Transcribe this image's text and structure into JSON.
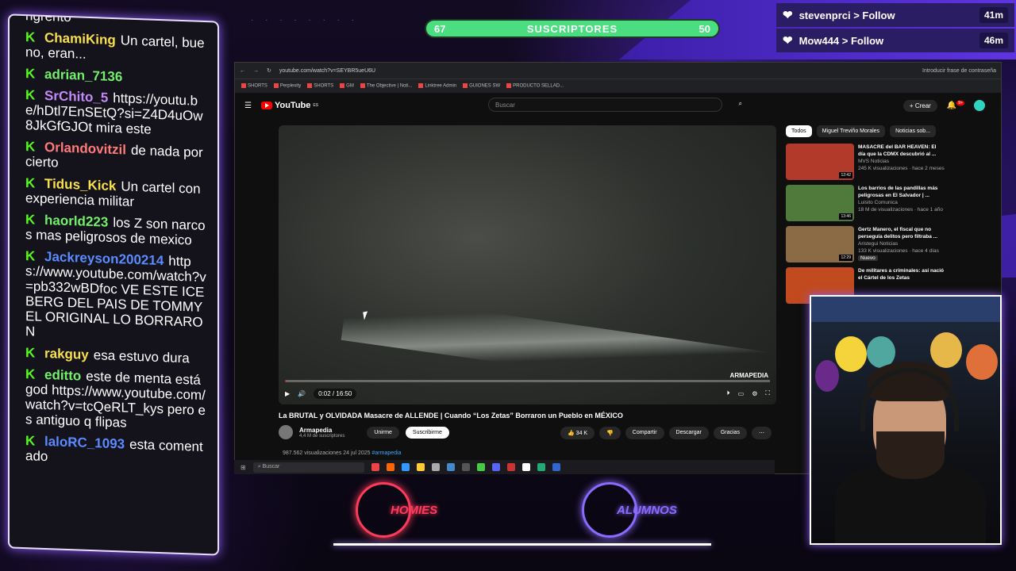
{
  "window": {
    "title": "Stream overlay - YouTube"
  },
  "subscribers": {
    "left": "67",
    "label": "SUSCRIPTORES",
    "right": "50",
    "progress": 0.5
  },
  "follows": [
    {
      "text": "stevenprci > Follow",
      "time": "41m"
    },
    {
      "text": "Mow444 > Follow",
      "time": "46m"
    }
  ],
  "chat": [
    {
      "user": "",
      "text": "ngrento",
      "color": "#ffffff"
    },
    {
      "user": "ChamiKing",
      "text": "Un cartel, bueno, eran...",
      "color": "#f7e04a"
    },
    {
      "user": "adrian_7136",
      "text": "",
      "color": "#72f06a"
    },
    {
      "user": "SrChito_5",
      "text": "https://youtu.be/hDtl7EnSEtQ?si=Z4D4uOw8JkGfGJOt mira este",
      "color": "#c58af9"
    },
    {
      "user": "Orlandovitzil",
      "text": "de nada por cierto",
      "color": "#ff7a7a"
    },
    {
      "user": "Tidus_Kick",
      "text": "Un cartel con experiencia militar",
      "color": "#f7e04a"
    },
    {
      "user": "haorld223",
      "text": "los Z son narcos mas peligrosos de mexico",
      "color": "#72f06a"
    },
    {
      "user": "Jackreyson200214",
      "text": "https://www.youtube.com/watch?v=pb332wBDfoc VE ESTE ICEBERG DEL PAIS DE TOMMY EL ORIGINAL LO BORRARON",
      "color": "#5b8cff"
    },
    {
      "user": "rakguy",
      "text": "esa estuvo dura",
      "color": "#f7e04a"
    },
    {
      "user": "editto",
      "text": "este de menta está god https://www.youtube.com/watch?v=tcQeRLT_kys pero es antiguo q flipas",
      "color": "#72f06a"
    },
    {
      "user": "laloRC_1093",
      "text": "esta comentado",
      "color": "#5b8cff"
    }
  ],
  "browser": {
    "url": "youtube.com/watch?v=SEYBR5ueU6U",
    "password_hint": "Introducir frase de contraseña",
    "bookmarks": [
      "SHORTS",
      "Perplexity",
      "SHORTS",
      "GM",
      "The Objective | Noti...",
      "Linktree Admin",
      "GUIONES SW",
      "PRODUCTO SELLAD..."
    ]
  },
  "youtube": {
    "logo": "YouTube",
    "region": "ES",
    "search_placeholder": "Buscar",
    "create_label": "Crear",
    "notif_count": "9+",
    "video": {
      "time": "0:02 / 16:50",
      "progress": 0.002,
      "watermark": "ARMAPEDIA",
      "title": "La BRUTAL y OLVIDADA Masacre de ALLENDE | Cuando “Los Zetas” Borraron un Pueblo en MÉXICO",
      "channel": "Armapedia",
      "subs": "4,4 M de suscriptores",
      "join": "Unirme",
      "subscribe": "Suscribirme",
      "likes": "34 K",
      "share": "Compartir",
      "download": "Descargar",
      "thanks": "Gracias",
      "views": "987.562 visualizaciones",
      "date": "24 jul 2025",
      "hashtag": "#armapedia"
    },
    "chips": [
      "Todos",
      "Miguel Treviño Morales",
      "Noticias sob..."
    ],
    "recs": [
      {
        "title": "MASACRE del BAR HEAVEN: El día que la CDMX descubrió al ...",
        "channel": "MVS Noticias",
        "meta": "245 K visualizaciones · hace 2 meses",
        "duration": "12:42",
        "color": "#b23a2a"
      },
      {
        "title": "Los barrios de las pandillas más peligrosas en El Salvador | ...",
        "channel": "Luisito Comunica",
        "meta": "18 M de visualizaciones · hace 1 año",
        "duration": "13:46",
        "color": "#4f7a3b"
      },
      {
        "title": "Gertz Manero, el fiscal que no perseguía delitos pero filtraba ...",
        "channel": "Aristegui Noticias",
        "meta": "133 K visualizaciones · hace 4 días",
        "duration": "12:29",
        "color": "#8a6b45",
        "badge": "Nuevo"
      },
      {
        "title": "De militares a criminales: así nació el Cártel de los Zetas",
        "channel": "",
        "meta": "",
        "duration": "",
        "color": "#c24a1f"
      }
    ]
  },
  "taskbar": {
    "search": "Buscar"
  },
  "logos": [
    {
      "name": "HOMIES",
      "color": "#ff3b5c"
    },
    {
      "name": "ALUMNOS",
      "color": "#8a6bff"
    }
  ]
}
